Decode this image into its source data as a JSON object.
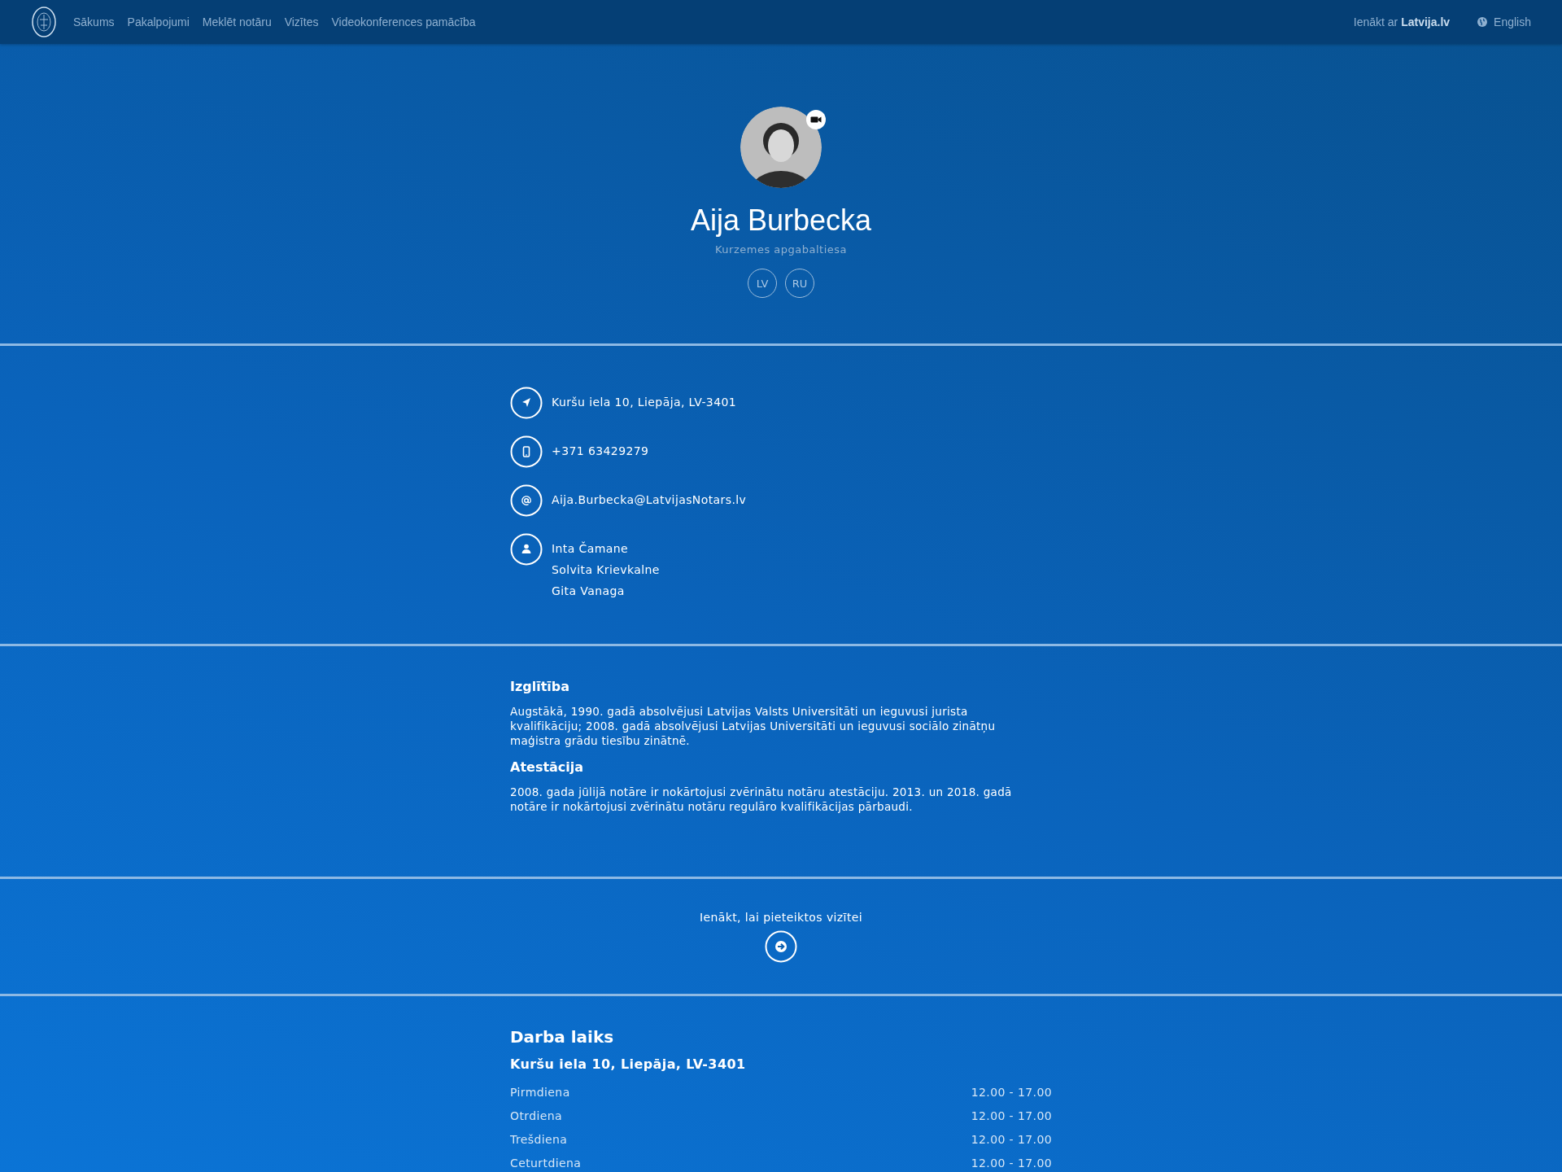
{
  "nav": {
    "items": [
      {
        "label": "Sākums"
      },
      {
        "label": "Pakalpojumi"
      },
      {
        "label": "Meklēt notāru"
      },
      {
        "label": "Vizītes"
      },
      {
        "label": "Videokonferences pamācība"
      }
    ],
    "login": "Ienākt ar **Latvija.lv**",
    "language": "English"
  },
  "profile": {
    "name": "Aija Burbecka",
    "court": "Kurzemes apgabaltiesa",
    "video": true,
    "languages": [
      "LV",
      "RU"
    ]
  },
  "contacts": [
    {
      "kind": "address",
      "lines": [
        "Kuršu iela 10, Liepāja, LV-3401"
      ]
    },
    {
      "kind": "phone",
      "lines": [
        "+371 63429279"
      ]
    },
    {
      "kind": "email",
      "lines": [
        "Aija.Burbecka@LatvijasNotars.lv"
      ]
    },
    {
      "kind": "staff",
      "lines": [
        "Inta Čamane",
        "Solvita Krievkalne",
        "Gita Vanaga"
      ]
    }
  ],
  "bio": [
    {
      "heading": "Izglītība",
      "text": "Augstākā, 1990. gadā absolvējusi Latvijas Valsts Universitāti un ieguvusi jurista kvalifikāciju; 2008. gadā absolvējusi Latvijas Universitāti un ieguvusi sociālo zinātņu maģistra grādu tiesību zinātnē."
    },
    {
      "heading": "Atestācija",
      "text": "2008. gada jūlijā notāre ir nokārtojusi zvērinātu notāru atestāciju. 2013. un 2018. gadā notāre ir nokārtojusi zvērinātu notāru regulāro kvalifikācijas pārbaudi."
    }
  ],
  "visit": {
    "label": "Ienākt, lai pieteiktos vizītei"
  },
  "hours": {
    "title": "Darba laiks",
    "address": "Kuršu iela 10, Liepāja, LV-3401",
    "rows": [
      {
        "day": "Pirmdiena",
        "time": "12.00 - 17.00"
      },
      {
        "day": "Otrdiena",
        "time": "12.00 - 17.00"
      },
      {
        "day": "Trešdiena",
        "time": "12.00 - 17.00"
      },
      {
        "day": "Ceturtdiena",
        "time": "12.00 - 17.00"
      }
    ]
  }
}
